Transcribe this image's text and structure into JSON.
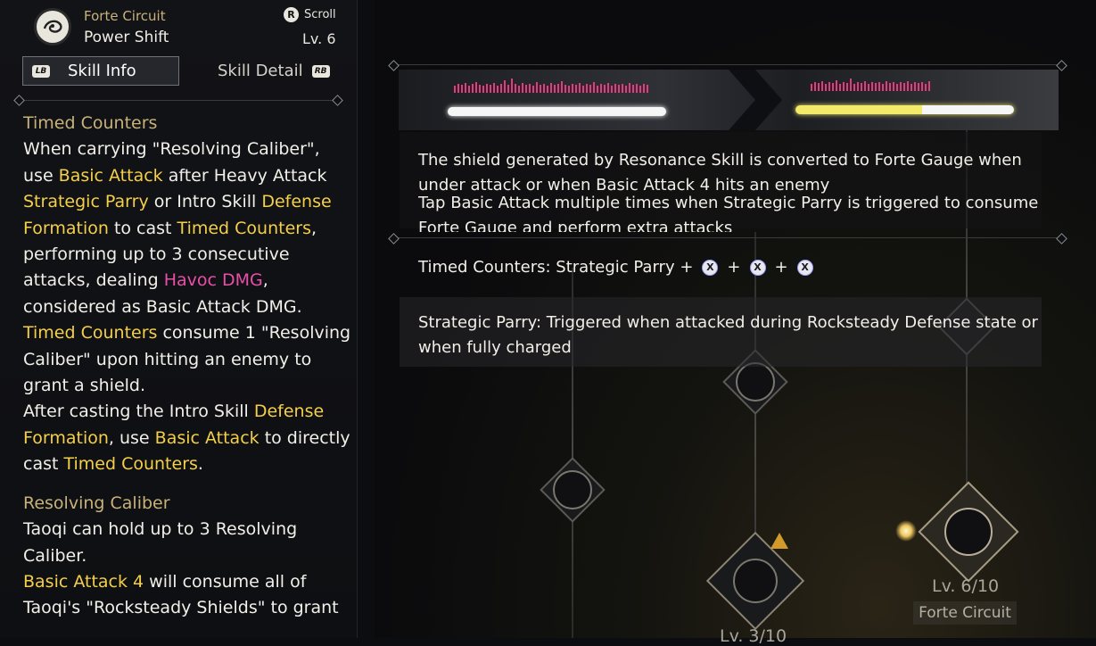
{
  "header": {
    "subtitle": "Forte Circuit",
    "title": "Power Shift",
    "scroll_key": "R",
    "scroll_label": "Scroll",
    "level": "Lv. 6",
    "icon": "forte-circuit-emblem-icon"
  },
  "tabs": {
    "info_key": "LB",
    "info_label": "Skill Info",
    "detail_label": "Skill Detail",
    "detail_key": "RB"
  },
  "skill": {
    "s1_title": "Timed Counters",
    "p1": {
      "a": "When carrying \"Resolving Caliber\", use ",
      "b": "Basic Attack",
      "c": " after Heavy Attack ",
      "d": "Strategic Parry",
      "e": " or Intro Skill ",
      "f": "Defense Formation",
      "g": " to cast ",
      "h": "Timed Counters",
      "i": ", performing up to 3 consecutive attacks, dealing ",
      "j": "Havoc DMG",
      "k": ", considered as Basic Attack DMG."
    },
    "p2": {
      "a": "Timed Counters",
      "b": " consume 1 \"Resolving Caliber\" upon hitting an enemy to grant a shield."
    },
    "p3": {
      "a": "After casting the Intro Skill ",
      "b": "Defense Formation",
      "c": ", use ",
      "d": "Basic Attack",
      "e": " to directly cast ",
      "f": "Timed Counters",
      "g": "."
    },
    "s2_title": "Resolving Caliber",
    "p4": "Taoqi can hold up to 3 Resolving Caliber.",
    "p5": {
      "a": "Basic Attack 4",
      "b": " will consume all of Taoqi's \"Rocksteady Shields\" to grant"
    }
  },
  "detail": {
    "desc1": "The shield generated by Resonance Skill is converted to Forte Gauge when under attack or when Basic Attack 4 hits an enemy",
    "desc2": "Tap Basic Attack multiple times when Strategic Parry is triggered to consume Forte Gauge and perform extra attacks",
    "combo_label": "Timed Counters: Strategic Parry +",
    "combo_key": "X",
    "combo_plus": "+",
    "parry_desc": "Strategic Parry: Triggered when attacked during Rocksteady Defense state or when fully charged"
  },
  "tree": {
    "main_level": "Lv. 6/10",
    "main_label": "Forte Circuit",
    "side_level": "Lv. 3/10"
  },
  "colors": {
    "highlight_yellow": "#f4cf4a",
    "havoc_magenta": "#e94fa8",
    "section_gold": "#c8b27a",
    "gauge_pink": "#e23c7e",
    "gauge_yellow": "#f3e96a"
  }
}
